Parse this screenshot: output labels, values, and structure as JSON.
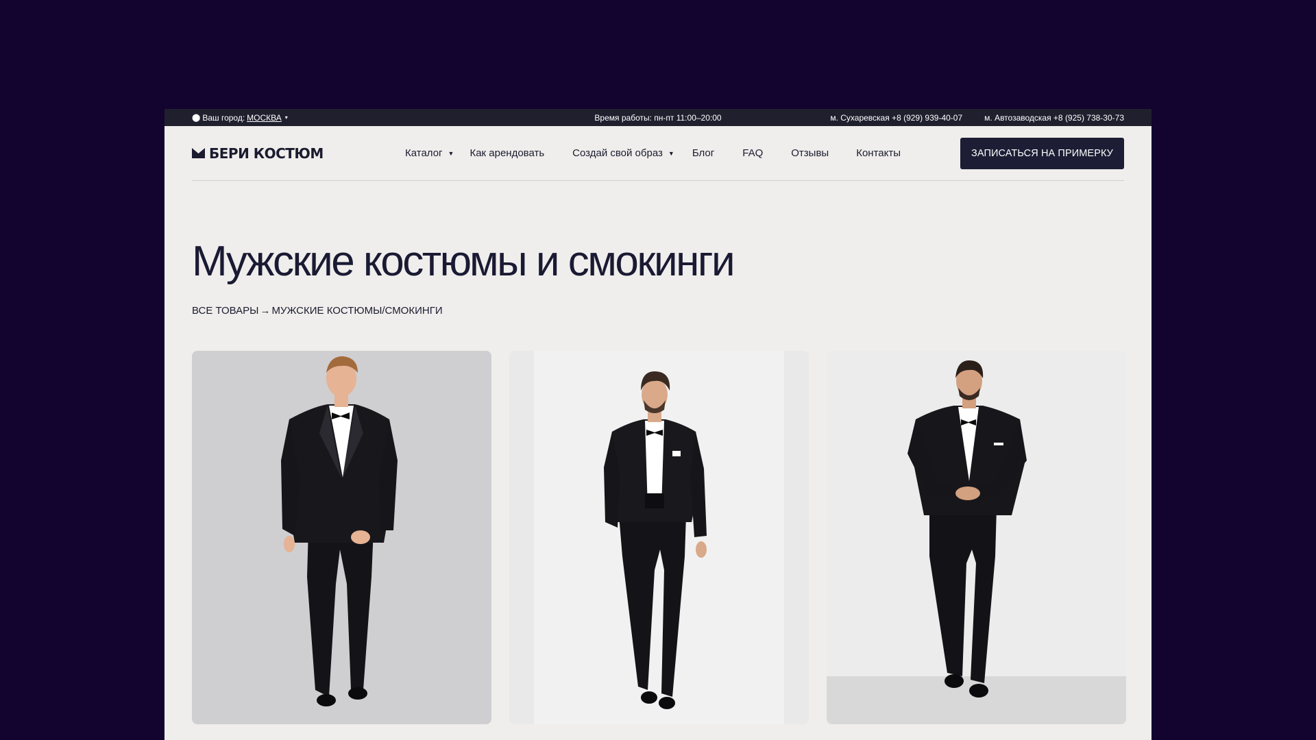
{
  "topbar": {
    "city_label": "Ваш город:",
    "city_value": "МОСКВА",
    "hours": "Время работы: пн-пт 11:00–20:00",
    "phone_1": "м. Сухаревская +8 (929) 939-40-07",
    "phone_2": "м. Автозаводская +8 (925) 738-30-73"
  },
  "header": {
    "logo_text": "БЕРИ КОСТЮМ",
    "nav": [
      {
        "label": "Каталог",
        "has_dropdown": true
      },
      {
        "label": "Как арендовать",
        "has_dropdown": false
      },
      {
        "label": "Создай свой образ",
        "has_dropdown": true
      },
      {
        "label": "Блог",
        "has_dropdown": false
      },
      {
        "label": "FAQ",
        "has_dropdown": false
      },
      {
        "label": "Отзывы",
        "has_dropdown": false
      },
      {
        "label": "Контакты",
        "has_dropdown": false
      }
    ],
    "cta_label": "ЗАПИСАТЬСЯ НА ПРИМЕРКУ"
  },
  "page": {
    "title": "Мужские костюмы и смокинги",
    "breadcrumb_root": "ВСЕ ТОВАРЫ",
    "breadcrumb_arrow": "→",
    "breadcrumb_current": "МУЖСКИЕ КОСТЮМЫ/СМОКИНГИ"
  },
  "products": [
    {
      "image": "tuxedo-model-photo-1",
      "bg_color": "#cfced1"
    },
    {
      "image": "tuxedo-model-photo-2",
      "bg_color": "#eeeeee"
    },
    {
      "image": "tuxedo-model-photo-3",
      "bg_color": "#e6e6e6"
    }
  ],
  "colors": {
    "page_bg": "#12032f",
    "site_bg": "#efeeec",
    "topbar_bg": "#1f1f2e",
    "cta_bg": "#1d1d35",
    "text": "#1b1b2f"
  }
}
